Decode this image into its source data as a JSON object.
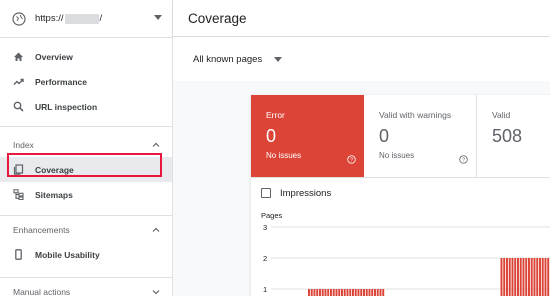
{
  "sidebar": {
    "property_url_prefix": "https://",
    "property_url_suffix": "/",
    "nav_main": [
      {
        "label": "Overview",
        "icon": "home-icon"
      },
      {
        "label": "Performance",
        "icon": "trending-up-icon"
      },
      {
        "label": "URL inspection",
        "icon": "search-icon"
      }
    ],
    "index_section": {
      "title": "Index",
      "items": [
        {
          "label": "Coverage",
          "icon": "coverage-icon",
          "active": true
        },
        {
          "label": "Sitemaps",
          "icon": "sitemap-icon"
        }
      ]
    },
    "enhancements_section": {
      "title": "Enhancements",
      "items": [
        {
          "label": "Mobile Usability",
          "icon": "phone-icon"
        }
      ]
    },
    "manual_actions_section": {
      "title": "Manual actions"
    }
  },
  "header": {
    "title": "Coverage"
  },
  "filter": {
    "label": "All known pages"
  },
  "tiles": {
    "error": {
      "label": "Error",
      "value": "0",
      "sub": "No issues"
    },
    "warnings": {
      "label": "Valid with warnings",
      "value": "0",
      "sub": "No issues"
    },
    "valid": {
      "label": "Valid",
      "value": "508"
    }
  },
  "impressions_label": "Impressions",
  "colors": {
    "error_red": "#db4437",
    "highlight": "#e8173d",
    "text": "#202124",
    "muted": "#5f6368"
  },
  "chart_data": {
    "type": "bar",
    "ylabel": "Pages",
    "y_ticks": [
      3,
      2,
      1
    ],
    "ylim": [
      0,
      3
    ],
    "series": [
      {
        "values": [
          1,
          1,
          1,
          1,
          1,
          1,
          1,
          1,
          1,
          1,
          1,
          1,
          1,
          1,
          1,
          1,
          1,
          1,
          1,
          1,
          1,
          1,
          1,
          1,
          1,
          1,
          1,
          1,
          0,
          0,
          0,
          0,
          0,
          0,
          0,
          0,
          0,
          0,
          0,
          0,
          0,
          0,
          0,
          0,
          0,
          0,
          0,
          0,
          0,
          0,
          0,
          0,
          0,
          0,
          0,
          0,
          0,
          0,
          0,
          0,
          0,
          0,
          0,
          0,
          0,
          0,
          0,
          0,
          0,
          0,
          2,
          2,
          2,
          2,
          2,
          2,
          2,
          2,
          2,
          2,
          2,
          2,
          2,
          2,
          2,
          2,
          2,
          2
        ]
      }
    ],
    "bar_color": "#db4437"
  }
}
